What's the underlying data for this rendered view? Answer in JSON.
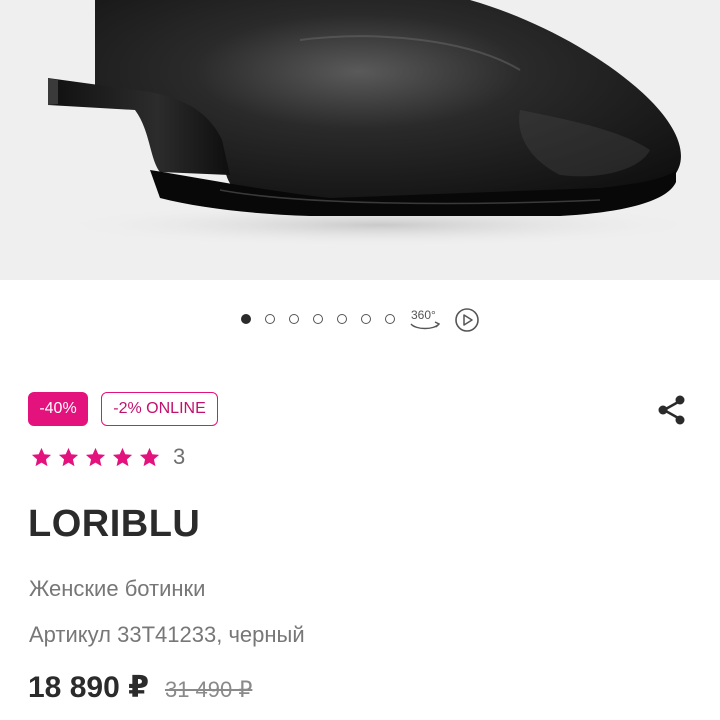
{
  "product": {
    "discount_badge": "-40%",
    "online_badge": "-2% ONLINE",
    "rating": {
      "stars": 5,
      "count": "3"
    },
    "brand": "LORIBLU",
    "category": "Женские ботинки",
    "article": "Артикул 33T41233, черный",
    "price": "18 890 ₽",
    "old_price": "31 490 ₽"
  },
  "gallery": {
    "total_photos": 7,
    "active_index": 0,
    "view_360_label": "360°",
    "icons": [
      "360-view-icon",
      "play-video-icon"
    ]
  },
  "colors": {
    "accent": "#e3127d",
    "text": "#2b2b2b",
    "muted": "#777777",
    "image_bg": "#efefef"
  },
  "icons": {
    "share": "share-icon",
    "star": "star-icon"
  }
}
